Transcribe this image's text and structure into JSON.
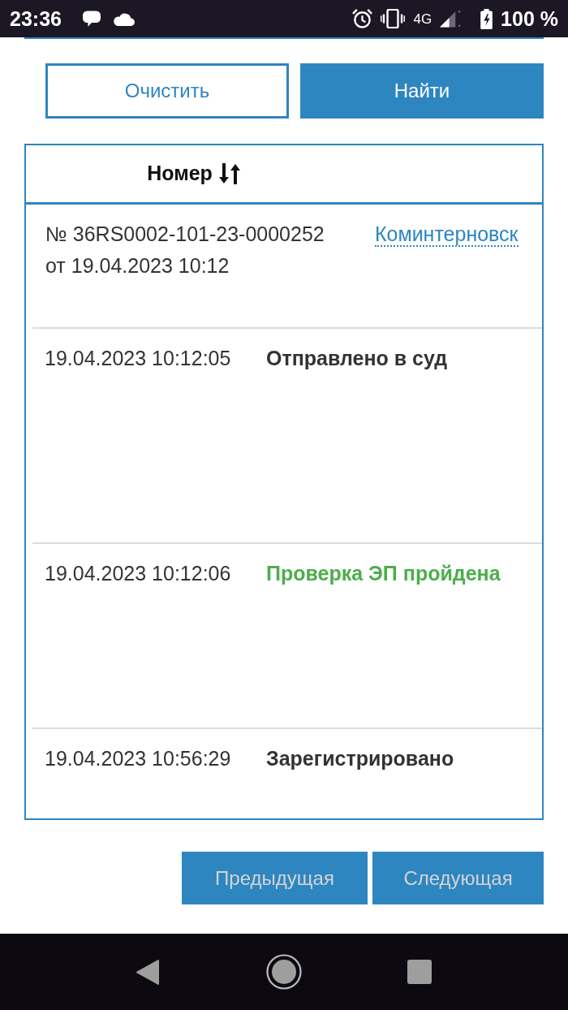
{
  "status_bar": {
    "time": "23:36",
    "network": "4G",
    "battery": "100 %"
  },
  "actions": [
    {
      "label": "Очистить",
      "kind": "outline"
    },
    {
      "label": "Найти",
      "kind": "primary"
    }
  ],
  "table": {
    "columns": [
      {
        "label": "Номер",
        "sortable": true
      }
    ],
    "case": {
      "number": "№ 36RS0002-101-23-0000252",
      "date": "от 19.04.2023 10:12",
      "court": "Коминтерновск"
    },
    "events": [
      {
        "time": "19.04.2023 10:12:05",
        "status": "Отправлено в суд",
        "color": "#333333"
      },
      {
        "time": "19.04.2023 10:12:06",
        "status": "Проверка ЭП пройдена",
        "color": "#4cae4c"
      },
      {
        "time": "19.04.2023 10:56:29",
        "status": "Зарегистрировано",
        "color": "#333333"
      }
    ]
  },
  "pagination": [
    {
      "label": "Предыдущая"
    },
    {
      "label": "Следующая"
    }
  ]
}
